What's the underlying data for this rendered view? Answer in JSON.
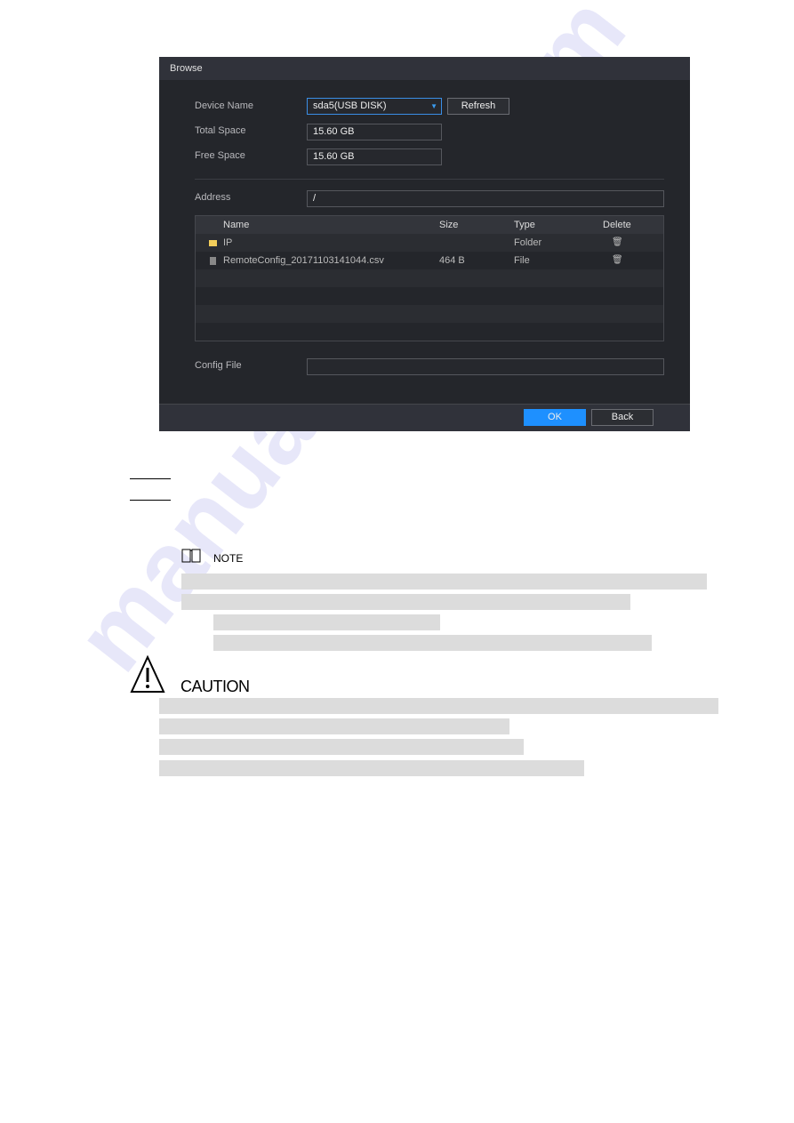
{
  "dialog": {
    "title": "Browse",
    "device_name_label": "Device Name",
    "device_name_value": "sda5(USB DISK)",
    "refresh_label": "Refresh",
    "total_space_label": "Total Space",
    "total_space_value": "15.60 GB",
    "free_space_label": "Free Space",
    "free_space_value": "15.60 GB",
    "address_label": "Address",
    "address_value": "/",
    "columns": {
      "name": "Name",
      "size": "Size",
      "type": "Type",
      "delete": "Delete"
    },
    "rows": [
      {
        "icon": "folder-icon",
        "name": "IP",
        "size": "",
        "type": "Folder"
      },
      {
        "icon": "file-icon",
        "name": "RemoteConfig_20171103141044.csv",
        "size": "464 B",
        "type": "File"
      }
    ],
    "config_file_label": "Config File",
    "config_file_value": "",
    "ok_label": "OK",
    "back_label": "Back"
  },
  "colors": {
    "accent": "#1e90ff",
    "dialog_bg": "#24262b"
  },
  "note": {
    "label": "NOTE"
  },
  "caution": {
    "label": "CAUTION"
  },
  "watermark": "manualshive.com"
}
